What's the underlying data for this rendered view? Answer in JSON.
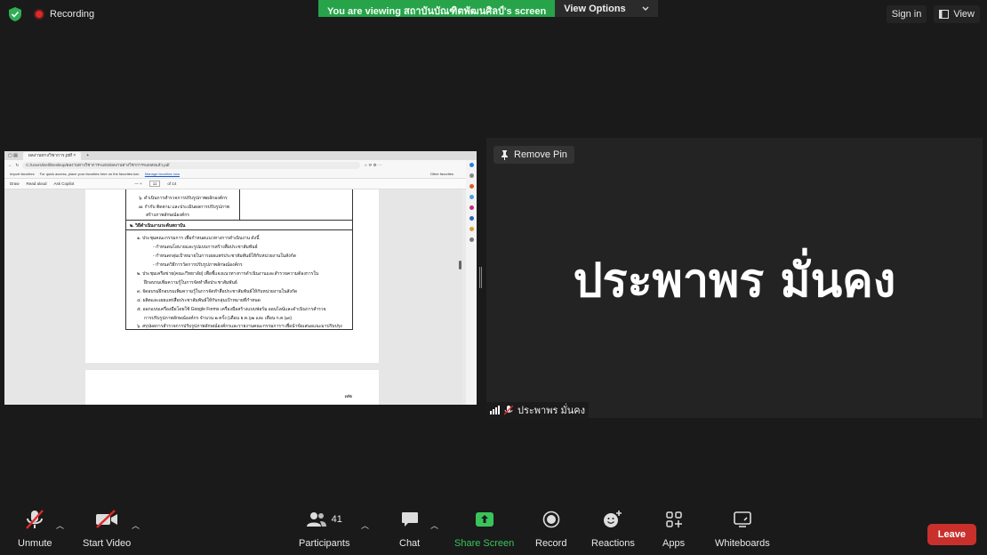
{
  "top": {
    "recording_label": "Recording",
    "banner_text": "You are viewing สถาบันบัณฑิตพัฒนศิลป์'s screen",
    "view_options": "View Options",
    "sign_in": "Sign in",
    "view": "View"
  },
  "shared": {
    "tab_title": "ผลงานทางวิชาการ.pdf",
    "url": "C:/Users/Dell/Desktop/ผลงานทางวิชาการ%202/ผลงานทางวิชาการ%20ส่งแล้ว.pdf",
    "fav_import": "Import favorites",
    "fav_hint": "For quick access, place your favorites here on the favorites bar.",
    "fav_manage": "Manage favorites now",
    "fav_other": "Other favorites",
    "tool_draw": "Draw",
    "tool_read": "Read aloud",
    "tool_copilot": "Ask Copilot",
    "page_current": "11",
    "page_total": "of 14",
    "table_top_1": "๖. ดำเนินการสำรวจการปรับรูปภาพผลักองค์กร",
    "table_top_2": "๗. กำกับ ติดตาม และประเมินผลการปรับรูปภาพ",
    "table_top_3": "สร้างภาพลักษณ์องค์กร",
    "table_header": "๒. วิธีดำเนินงานระดับสถาบัน",
    "lines": [
      "๑. ประชุมคณะกรรมการ เพื่อกำหนดแนวทางการดำเนินงาน ดังนี้",
      "- กำหนดนโยบายและรูปแบบการสร้างสื่อประชาสัมพันธ์",
      "- กำหนดกลุ่มเป้าหมายในการเผยแพร่ประชาสัมพันธ์ให้กับหน่วยงานในสังกัด",
      "- กำหนดวิธีการวัดการปรับรูปภาพลักษณ์องค์กร",
      "๒. ประชุมเครือข่าย(คณะ/วิทยาลัย) เพื่อชี้แจงแนวทางการดำเนินงานและสำรวจความต้องการใน",
      "ฝึกอบรมเพิ่มความรู้ในการจัดทำสื่อประชาสัมพันธ์",
      "๓. จัดอบรมฝึกอบรมเพิ่มความรู้ในการจัดทำสื่อประชาสัมพันธ์ให้กับหน่วยงานในสังกัด",
      "๔. ผลิตและเผยแพร่สื่อประชาสัมพันธ์ให้กับกลุ่มเป้าหมายที่กำหนด",
      "๕. ออกแบบเครื่องมือโดยใช้ Google Forms เครื่องมือสร้างแบบฟอร์ม ออนไลน์และดำเนินการสำรวจ",
      "การปรับรูปภาพลักษณ์องค์กร จำนวน ๒ ครั้ง (เดือน ธ.ค.๖๒ และ เดือน ก.ค.๖๓)",
      "๖. สรุปผลการสำรวจการปรับรูปภาพลักษณ์องค์กรและรายงานคณะกรรมการฯ เพื่อนำข้อเสนอแนะมาปรับปรุง"
    ],
    "page2_number": "๗๒"
  },
  "tile": {
    "remove_pin": "Remove Pin",
    "display_name": "ประพาพร มั่นคง",
    "footer_name": "ประพาพร มั่นคง"
  },
  "toolbar": {
    "unmute": "Unmute",
    "start_video": "Start Video",
    "participants": "Participants",
    "participants_count": "41",
    "chat": "Chat",
    "share_screen": "Share Screen",
    "record": "Record",
    "reactions": "Reactions",
    "apps": "Apps",
    "whiteboards": "Whiteboards",
    "leave": "Leave"
  },
  "colors": {
    "banner_green": "#27a34a",
    "share_green": "#39c45b",
    "leave_red": "#c9302c",
    "mute_red": "#e02828"
  }
}
